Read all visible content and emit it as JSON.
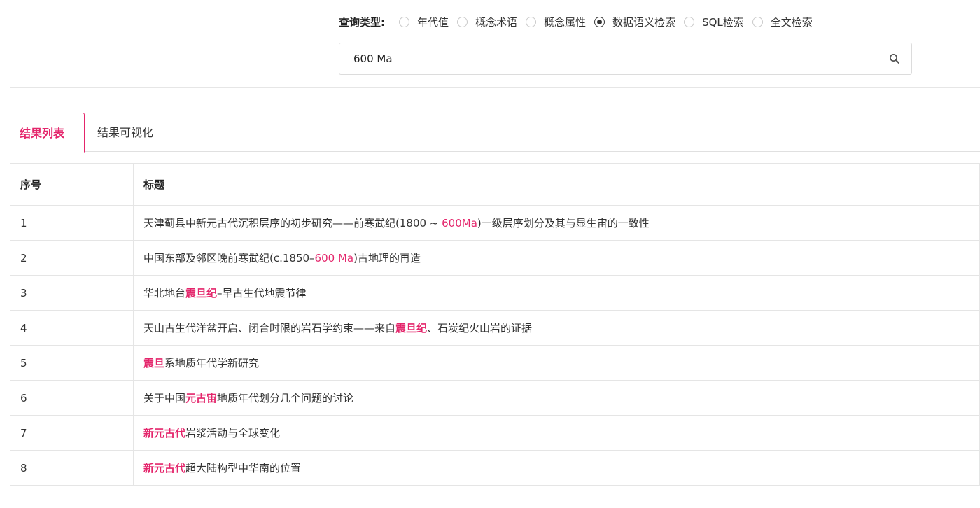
{
  "query": {
    "label": "查询类型:",
    "options": [
      {
        "label": "年代值",
        "checked": false
      },
      {
        "label": "概念术语",
        "checked": false
      },
      {
        "label": "概念属性",
        "checked": false
      },
      {
        "label": "数据语义检索",
        "checked": true
      },
      {
        "label": "SQL检索",
        "checked": false
      },
      {
        "label": "全文检索",
        "checked": false
      }
    ]
  },
  "search": {
    "value": "600 Ma",
    "icon": "search-icon"
  },
  "tabs": [
    {
      "label": "结果列表",
      "active": true
    },
    {
      "label": "结果可视化",
      "active": false
    }
  ],
  "table": {
    "headers": [
      "序号",
      "标题"
    ],
    "rows": [
      {
        "no": "1",
        "segments": [
          {
            "text": "天津蓟县中新元古代沉积层序的初步研究——前寒武纪(1800 ~ "
          },
          {
            "text": "600Ma",
            "hl": true
          },
          {
            "text": ")一级层序划分及其与显生宙的一致性"
          }
        ]
      },
      {
        "no": "2",
        "segments": [
          {
            "text": "中国东部及邻区晚前寒武纪(c.1850–"
          },
          {
            "text": "600 Ma",
            "hl": true
          },
          {
            "text": ")古地理的再造"
          }
        ]
      },
      {
        "no": "3",
        "segments": [
          {
            "text": "华北地台"
          },
          {
            "text": "震旦纪",
            "hl": true,
            "bold": true
          },
          {
            "text": "–早古生代地震节律"
          }
        ]
      },
      {
        "no": "4",
        "segments": [
          {
            "text": "天山古生代洋盆开启、闭合时限的岩石学约束——来自"
          },
          {
            "text": "震旦纪",
            "hl": true,
            "bold": true
          },
          {
            "text": "、石炭纪火山岩的证据"
          }
        ]
      },
      {
        "no": "5",
        "segments": [
          {
            "text": "震旦",
            "hl": true,
            "bold": true
          },
          {
            "text": "系地质年代学新研究"
          }
        ]
      },
      {
        "no": "6",
        "segments": [
          {
            "text": "关于中国"
          },
          {
            "text": "元古宙",
            "hl": true,
            "bold": true
          },
          {
            "text": "地质年代划分几个问题的讨论"
          }
        ]
      },
      {
        "no": "7",
        "segments": [
          {
            "text": "新元古代",
            "hl": true,
            "bold": true
          },
          {
            "text": "岩浆活动与全球变化"
          }
        ]
      },
      {
        "no": "8",
        "segments": [
          {
            "text": "新元古代",
            "hl": true,
            "bold": true
          },
          {
            "text": "超大陆构型中华南的位置"
          }
        ]
      }
    ]
  }
}
